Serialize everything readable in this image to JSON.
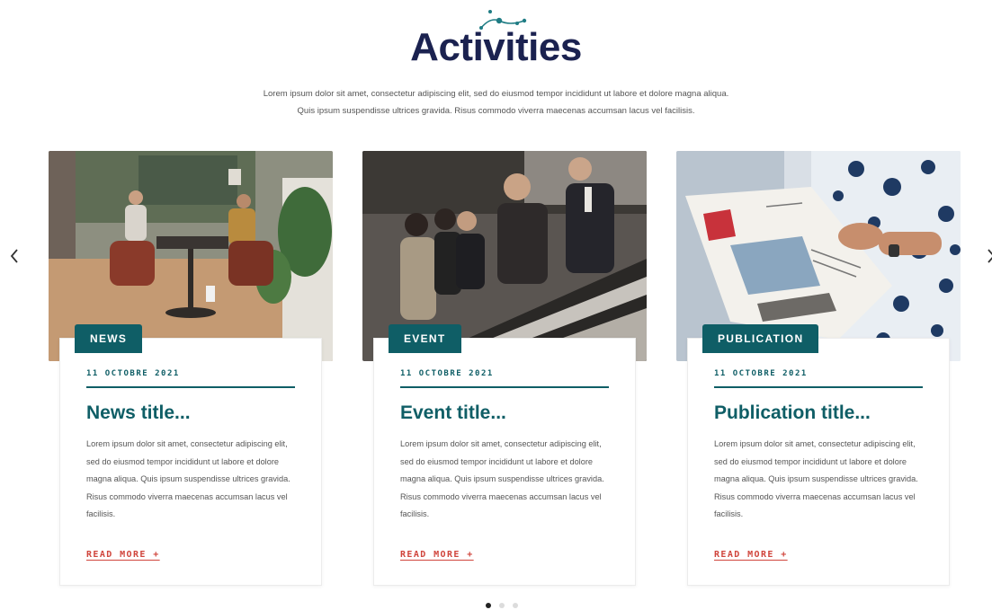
{
  "header": {
    "title": "Activities",
    "intro_line1": "Lorem ipsum dolor sit amet, consectetur adipiscing elit, sed do eiusmod tempor incididunt ut labore et dolore magna aliqua.",
    "intro_line2": "Quis ipsum suspendisse ultrices gravida. Risus commodo viverra maecenas accumsan lacus vel facilisis."
  },
  "carousel": {
    "prev_icon": "chevron-left-icon",
    "next_icon": "chevron-right-icon",
    "active_page": 1,
    "page_count": 3
  },
  "cards": [
    {
      "category": "NEWS",
      "date": "11 OCTOBRE 2021",
      "title": "News title...",
      "text": "Lorem ipsum dolor sit amet, consectetur adipiscing elit, sed do eiusmod tempor incididunt ut labore et dolore magna aliqua. Quis ipsum suspendisse ultrices gravida. Risus commodo viverra maecenas accumsan lacus vel facilisis.",
      "link": "READ MORE +"
    },
    {
      "category": "EVENT",
      "date": "11 OCTOBRE 2021",
      "title": "Event title...",
      "text": "Lorem ipsum dolor sit amet, consectetur adipiscing elit, sed do eiusmod tempor incididunt ut labore et dolore magna aliqua. Quis ipsum suspendisse ultrices gravida. Risus commodo viverra maecenas accumsan lacus vel facilisis.",
      "link": "READ MORE +"
    },
    {
      "category": "PUBLICATION",
      "date": "11 OCTOBRE 2021",
      "title": "Publication title...",
      "text": "Lorem ipsum dolor sit amet, consectetur adipiscing elit, sed do eiusmod tempor incididunt ut labore et dolore magna aliqua. Quis ipsum suspendisse ultrices gravida. Risus commodo viverra maecenas accumsan lacus vel facilisis.",
      "link": "READ MORE +"
    }
  ],
  "colors": {
    "title": "#1b2250",
    "accent_teal": "#0f5e66",
    "link_red": "#d0453c",
    "body_text": "#555555"
  }
}
